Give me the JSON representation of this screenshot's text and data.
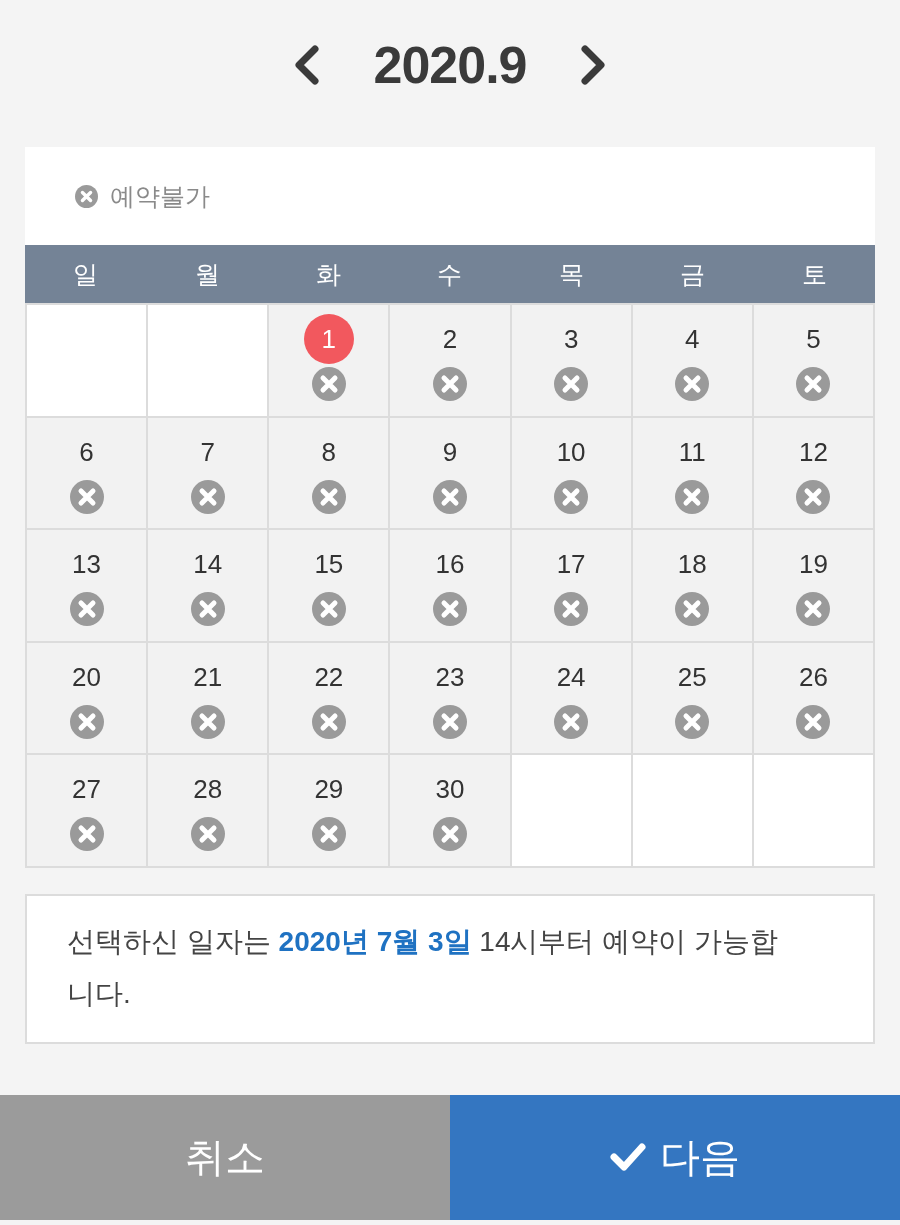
{
  "header": {
    "title": "2020.9"
  },
  "legend": {
    "label": "예약불가"
  },
  "calendar": {
    "weekdays": [
      "일",
      "월",
      "화",
      "수",
      "목",
      "금",
      "토"
    ],
    "cells": [
      {
        "kind": "empty"
      },
      {
        "kind": "empty"
      },
      {
        "kind": "date",
        "day": "1",
        "today": true,
        "unavailable": true
      },
      {
        "kind": "date",
        "day": "2",
        "today": false,
        "unavailable": true
      },
      {
        "kind": "date",
        "day": "3",
        "today": false,
        "unavailable": true
      },
      {
        "kind": "date",
        "day": "4",
        "today": false,
        "unavailable": true
      },
      {
        "kind": "date",
        "day": "5",
        "today": false,
        "unavailable": true
      },
      {
        "kind": "date",
        "day": "6",
        "today": false,
        "unavailable": true
      },
      {
        "kind": "date",
        "day": "7",
        "today": false,
        "unavailable": true
      },
      {
        "kind": "date",
        "day": "8",
        "today": false,
        "unavailable": true
      },
      {
        "kind": "date",
        "day": "9",
        "today": false,
        "unavailable": true
      },
      {
        "kind": "date",
        "day": "10",
        "today": false,
        "unavailable": true
      },
      {
        "kind": "date",
        "day": "11",
        "today": false,
        "unavailable": true
      },
      {
        "kind": "date",
        "day": "12",
        "today": false,
        "unavailable": true
      },
      {
        "kind": "date",
        "day": "13",
        "today": false,
        "unavailable": true
      },
      {
        "kind": "date",
        "day": "14",
        "today": false,
        "unavailable": true
      },
      {
        "kind": "date",
        "day": "15",
        "today": false,
        "unavailable": true
      },
      {
        "kind": "date",
        "day": "16",
        "today": false,
        "unavailable": true
      },
      {
        "kind": "date",
        "day": "17",
        "today": false,
        "unavailable": true
      },
      {
        "kind": "date",
        "day": "18",
        "today": false,
        "unavailable": true
      },
      {
        "kind": "date",
        "day": "19",
        "today": false,
        "unavailable": true
      },
      {
        "kind": "date",
        "day": "20",
        "today": false,
        "unavailable": true
      },
      {
        "kind": "date",
        "day": "21",
        "today": false,
        "unavailable": true
      },
      {
        "kind": "date",
        "day": "22",
        "today": false,
        "unavailable": true
      },
      {
        "kind": "date",
        "day": "23",
        "today": false,
        "unavailable": true
      },
      {
        "kind": "date",
        "day": "24",
        "today": false,
        "unavailable": true
      },
      {
        "kind": "date",
        "day": "25",
        "today": false,
        "unavailable": true
      },
      {
        "kind": "date",
        "day": "26",
        "today": false,
        "unavailable": true
      },
      {
        "kind": "date",
        "day": "27",
        "today": false,
        "unavailable": true
      },
      {
        "kind": "date",
        "day": "28",
        "today": false,
        "unavailable": true
      },
      {
        "kind": "date",
        "day": "29",
        "today": false,
        "unavailable": true
      },
      {
        "kind": "date",
        "day": "30",
        "today": false,
        "unavailable": true
      },
      {
        "kind": "empty"
      },
      {
        "kind": "empty"
      },
      {
        "kind": "empty"
      }
    ]
  },
  "notice": {
    "text": "선택하신 일자는 **2020년 7월 3일** 14시부터 예약이 가능합니다."
  },
  "buttons": [
    {
      "kind": "cancel",
      "label": "취소"
    },
    {
      "kind": "next",
      "label": "다음"
    }
  ]
}
